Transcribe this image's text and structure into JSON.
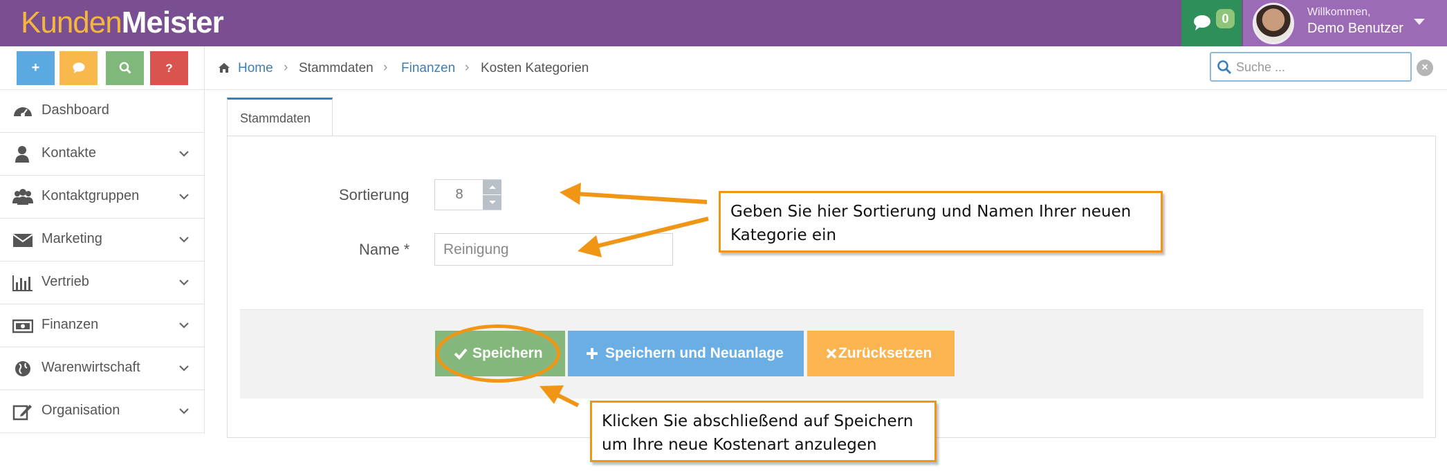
{
  "header": {
    "logo_part1": "Kunden",
    "logo_part2": "Meister",
    "messages_count": "0",
    "welcome": "Willkommen,",
    "username": "Demo Benutzer"
  },
  "quick_actions": [
    {
      "label": "+",
      "color": "#5aa9e0",
      "icon": "plus-icon"
    },
    {
      "label": "",
      "color": "#f8b84e",
      "icon": "comment-icon"
    },
    {
      "label": "",
      "color": "#7fb87a",
      "icon": "search-icon"
    },
    {
      "label": "?",
      "color": "#d9534f",
      "icon": "help-icon"
    }
  ],
  "sidebar": {
    "items": [
      {
        "label": "Dashboard",
        "icon": "dashboard-icon"
      },
      {
        "label": "Kontakte",
        "icon": "user-icon"
      },
      {
        "label": "Kontaktgruppen",
        "icon": "users-icon"
      },
      {
        "label": "Marketing",
        "icon": "envelope-icon"
      },
      {
        "label": "Vertrieb",
        "icon": "bar-chart-icon"
      },
      {
        "label": "Finanzen",
        "icon": "money-icon"
      },
      {
        "label": "Warenwirtschaft",
        "icon": "globe-icon"
      },
      {
        "label": "Organisation",
        "icon": "edit-icon"
      }
    ]
  },
  "breadcrumb": {
    "home": "Home",
    "items": [
      "Stammdaten",
      "Finanzen",
      "Kosten Kategorien"
    ]
  },
  "search": {
    "placeholder": "Suche ..."
  },
  "tab": {
    "label": "Stammdaten"
  },
  "form": {
    "sort_label": "Sortierung",
    "sort_value": "8",
    "name_label": "Name *",
    "name_value": "",
    "name_placeholder": "Reinigung"
  },
  "buttons": {
    "save": "Speichern",
    "save_new": "Speichern und Neuanlage",
    "reset": "Zurücksetzen"
  },
  "callouts": {
    "first": "Geben Sie hier Sortierung und Namen Ihrer neuen Kategorie ein",
    "second": "Klicken Sie abschließend auf Speichern um Ihre neue Kostenart anzulegen"
  },
  "colors": {
    "header": "#7a4f92",
    "annotation": "#f09514",
    "save": "#84b77c",
    "save_new": "#6aaee4",
    "reset": "#fbb44f"
  }
}
